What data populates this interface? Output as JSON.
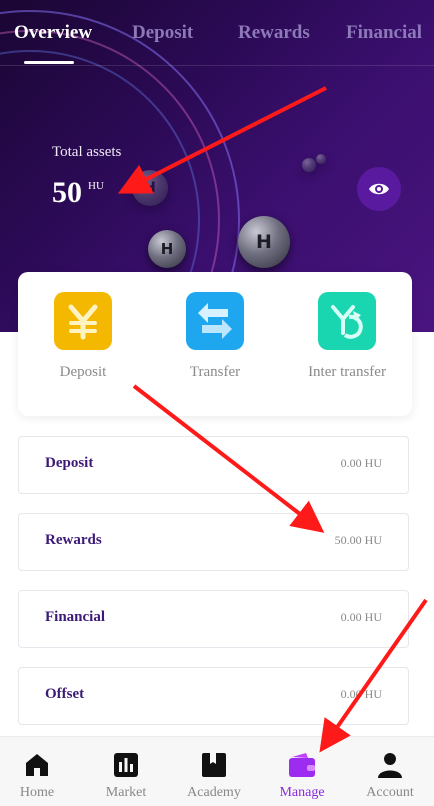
{
  "header": {
    "tabs": [
      {
        "label": "Overview",
        "active": true
      },
      {
        "label": "Deposit",
        "active": false
      },
      {
        "label": "Rewards",
        "active": false
      },
      {
        "label": "Financial",
        "active": false
      }
    ],
    "total_assets_label": "Total assets",
    "total_assets_value": "50",
    "total_assets_unit": "HU",
    "eye_icon": "eye-icon"
  },
  "actions": [
    {
      "label": "Deposit",
      "icon": "yen-icon",
      "color": "#f5b800"
    },
    {
      "label": "Transfer",
      "icon": "transfer-arrow-icon",
      "color": "#1ea7ef"
    },
    {
      "label": "Inter transfer",
      "icon": "inter-transfer-icon",
      "color": "#19d6b0"
    }
  ],
  "balances": [
    {
      "name": "Deposit",
      "value": "0.00 HU"
    },
    {
      "name": "Rewards",
      "value": "50.00 HU"
    },
    {
      "name": "Financial",
      "value": "0.00 HU"
    },
    {
      "name": "Offset",
      "value": "0.00 HU"
    }
  ],
  "nav": [
    {
      "label": "Home",
      "icon": "home-icon",
      "active": false
    },
    {
      "label": "Market",
      "icon": "market-icon",
      "active": false
    },
    {
      "label": "Academy",
      "icon": "book-icon",
      "active": false
    },
    {
      "label": "Manage",
      "icon": "wallet-icon",
      "active": true
    },
    {
      "label": "Account",
      "icon": "user-icon",
      "active": false
    }
  ],
  "colors": {
    "accent": "#8a2be2",
    "heading_purple": "#3d1a78",
    "annotation_arrow": "#ff1a1a"
  }
}
